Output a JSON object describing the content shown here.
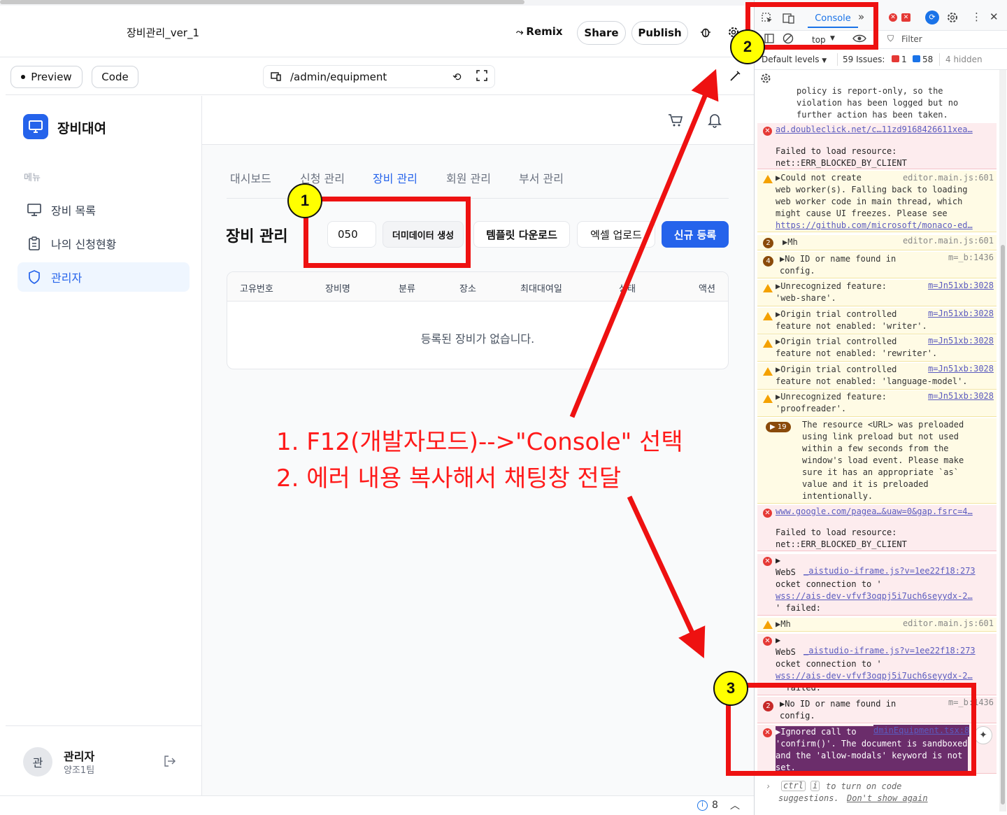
{
  "topbar": {
    "project_title": "장비관리_ver_1",
    "remix_label": "Remix",
    "share_label": "Share",
    "publish_label": "Publish"
  },
  "secondbar": {
    "preview_label": "Preview",
    "code_label": "Code",
    "url_path": "/admin/equipment"
  },
  "sidebar": {
    "brand": "장비대여",
    "menu_label": "메뉴",
    "items": [
      {
        "label": "장비 목록",
        "icon": "monitor-icon"
      },
      {
        "label": "나의 신청현황",
        "icon": "clipboard-icon"
      },
      {
        "label": "관리자",
        "icon": "shield-icon",
        "active": true
      }
    ],
    "user": {
      "avatar": "관",
      "name": "관리자",
      "team": "양조1팀"
    }
  },
  "main": {
    "tabs": [
      {
        "label": "대시보드"
      },
      {
        "label": "신청 관리"
      },
      {
        "label": "장비 관리",
        "active": true
      },
      {
        "label": "회원 관리"
      },
      {
        "label": "부서 관리"
      }
    ],
    "section_title": "장비 관리",
    "count_input_value": "050",
    "dummy_button": "더미데이터 생성",
    "template_button": "템플릿 다운로드",
    "excel_button": "엑셀 업로드",
    "new_button": "신규 등록",
    "table_headers": [
      "고유번호",
      "장비명",
      "분류",
      "장소",
      "최대대여일",
      "상태",
      "액션"
    ],
    "empty_message": "등록된 장비가 없습니다."
  },
  "footer": {
    "info_count": "8"
  },
  "devtools": {
    "console_tab": "Console",
    "context": "top",
    "filter_placeholder": "Filter",
    "levels": "Default levels",
    "issues_label": "59 Issues:",
    "issues_err": "1",
    "issues_msg": "58",
    "hidden": "4 hidden",
    "logs": [
      {
        "type": "info",
        "text": "policy is report-only, so the\nviolation has been logged but no\nfurther action has been taken."
      },
      {
        "type": "error",
        "link": "ad.doubleclick.net/c…11zd9168426611xea…",
        "text": "Failed to load resource:\nnet::ERR_BLOCKED_BY_CLIENT"
      },
      {
        "type": "warn",
        "text": "▶Could not create\nweb worker(s). Falling back to loading\nweb worker code in main thread, which\nmight cause UI freezes. Please see",
        "link": "https://github.com/microsoft/monaco-ed…",
        "src": "editor.main.js:601"
      },
      {
        "type": "warn",
        "count": "2",
        "text": "▶Mh",
        "src": "editor.main.js:601"
      },
      {
        "type": "warn",
        "count": "4",
        "text": "▶No ID or name found in\nconfig.",
        "src": "m=_b:1436"
      },
      {
        "type": "warn",
        "text": "▶Unrecognized feature:\n'web-share'.",
        "src": "m=Jn51xb:3028"
      },
      {
        "type": "warn",
        "text": "▶Origin trial controlled\nfeature not enabled: 'writer'.",
        "src": "m=Jn51xb:3028"
      },
      {
        "type": "warn",
        "text": "▶Origin trial controlled\nfeature not enabled: 'rewriter'.",
        "src": "m=Jn51xb:3028"
      },
      {
        "type": "warn",
        "text": "▶Origin trial controlled\nfeature not enabled: 'language-model'.",
        "src": "m=Jn51xb:3028"
      },
      {
        "type": "warn",
        "text": "▶Unrecognized feature:\n'proofreader'.",
        "src": "m=Jn51xb:3028"
      },
      {
        "type": "warn",
        "count": "▶ 19",
        "text": "The resource <URL> was preloaded\nusing link preload but not used\nwithin a few seconds from the\nwindow's load event. Please make\nsure it has an appropriate `as`\nvalue and it is preloaded\nintentionally."
      },
      {
        "type": "error",
        "link": "www.google.com/pagea…&uaw=0&gap.fsrc=4…",
        "text": "Failed to load resource:\nnet::ERR_BLOCKED_BY_CLIENT"
      },
      {
        "type": "error",
        "text": "▶\nWebS\nocket connection to '\n\n' failed:",
        "link": "_aistudio-iframe.js?v=1ee22f18:273",
        "link2": "wss://ais-dev-vfvf3oqpj5i7uch6seyydx-2…"
      },
      {
        "type": "warn",
        "text": "▶Mh",
        "src": "editor.main.js:601"
      },
      {
        "type": "error",
        "text": "▶\nWebS\nocket connection to '\n\n' failed:",
        "link": "_aistudio-iframe.js?v=1ee22f18:273",
        "link2": "wss://ais-dev-vfvf3oqpj5i7uch6seyydx-2…"
      },
      {
        "type": "error",
        "count": "2",
        "text": "▶No ID or name found in\nconfig.",
        "src": "m=_b:1436"
      },
      {
        "type": "error",
        "text": "▶Ignored call to\n'confirm()'. The document is sandboxed\nand the 'allow-modals' keyword is not\nset.",
        "link": "dminEquipment.tsx:8"
      }
    ],
    "hint": "ctrl i to turn on code\nsuggestions. Don't show again",
    "hint_ctrl": "ctrl",
    "hint_i": "i",
    "hint_rest": "to turn on code",
    "hint_line2": "suggestions.",
    "hint_dont": "Don't show again"
  },
  "annotations": {
    "badge1": "1",
    "badge2": "2",
    "badge3": "3",
    "line1": "1. F12(개발자모드)-->\"Console\" 선택",
    "line2": "2. 에러 내용 복사해서 채팅창 전달",
    "color": "#ee1111"
  }
}
